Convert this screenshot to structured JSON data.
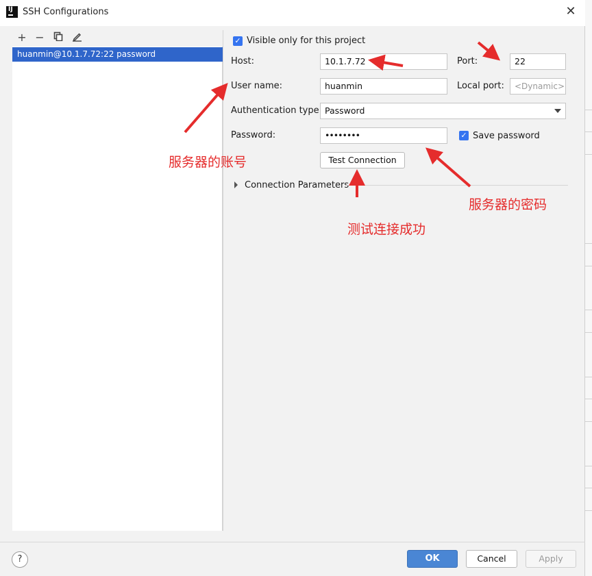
{
  "window": {
    "app_icon_text": "IJ",
    "title": "SSH Configurations",
    "close_glyph": "✕"
  },
  "toolbar": {
    "add_glyph": "+",
    "remove_glyph": "−",
    "copy_icon": "copy-icon",
    "edit_icon": "pencil-icon"
  },
  "list": {
    "items": [
      {
        "label": "huanmin@10.1.7.72:22 password",
        "selected": true
      }
    ]
  },
  "form": {
    "visible_checkbox_label": "Visible only for this project",
    "host_label": "Host:",
    "host_value": "10.1.7.72",
    "port_label": "Port:",
    "port_value": "22",
    "user_label": "User name:",
    "user_value": "huanmin",
    "local_port_label": "Local port:",
    "local_port_placeholder": "<Dynamic>",
    "auth_label": "Authentication type:",
    "auth_value": "Password",
    "password_label": "Password:",
    "password_value": "••••••••",
    "save_password_label": "Save password",
    "test_button_label": "Test Connection",
    "conn_params_label": "Connection Parameters"
  },
  "footer": {
    "help_label": "?",
    "ok_label": "OK",
    "cancel_label": "Cancel",
    "apply_label": "Apply"
  },
  "annotations": {
    "account": "服务器的账号",
    "password": "服务器的密码",
    "test_success": "测试连接成功"
  },
  "colors": {
    "selection": "#2f65ca",
    "checkbox": "#3574f0",
    "ok_button": "#4a86d4",
    "annotation": "#e52c2c"
  }
}
